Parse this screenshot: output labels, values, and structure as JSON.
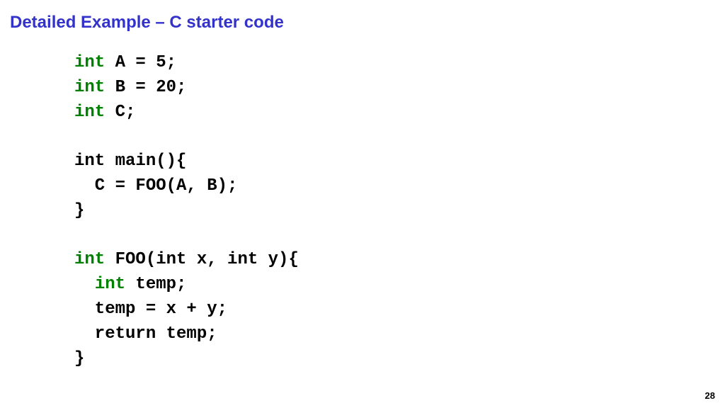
{
  "title": "Detailed Example – C starter code",
  "pageNumber": "28",
  "code": {
    "l0_kw": "int",
    "l0_rest": " A = 5;",
    "l1_kw": "int",
    "l1_rest": " B = 20;",
    "l2_kw": "int",
    "l2_rest": " C;",
    "l3": "",
    "l4": "int main(){",
    "l5": "  C = FOO(A, B);",
    "l6": "}",
    "l7": "",
    "l8_kw": "int",
    "l8_rest": " FOO(int x, int y){",
    "l9_pre": "  ",
    "l9_kw": "int",
    "l9_rest": " temp;",
    "l10": "  temp = x + y;",
    "l11": "  return temp;",
    "l12": "}"
  }
}
